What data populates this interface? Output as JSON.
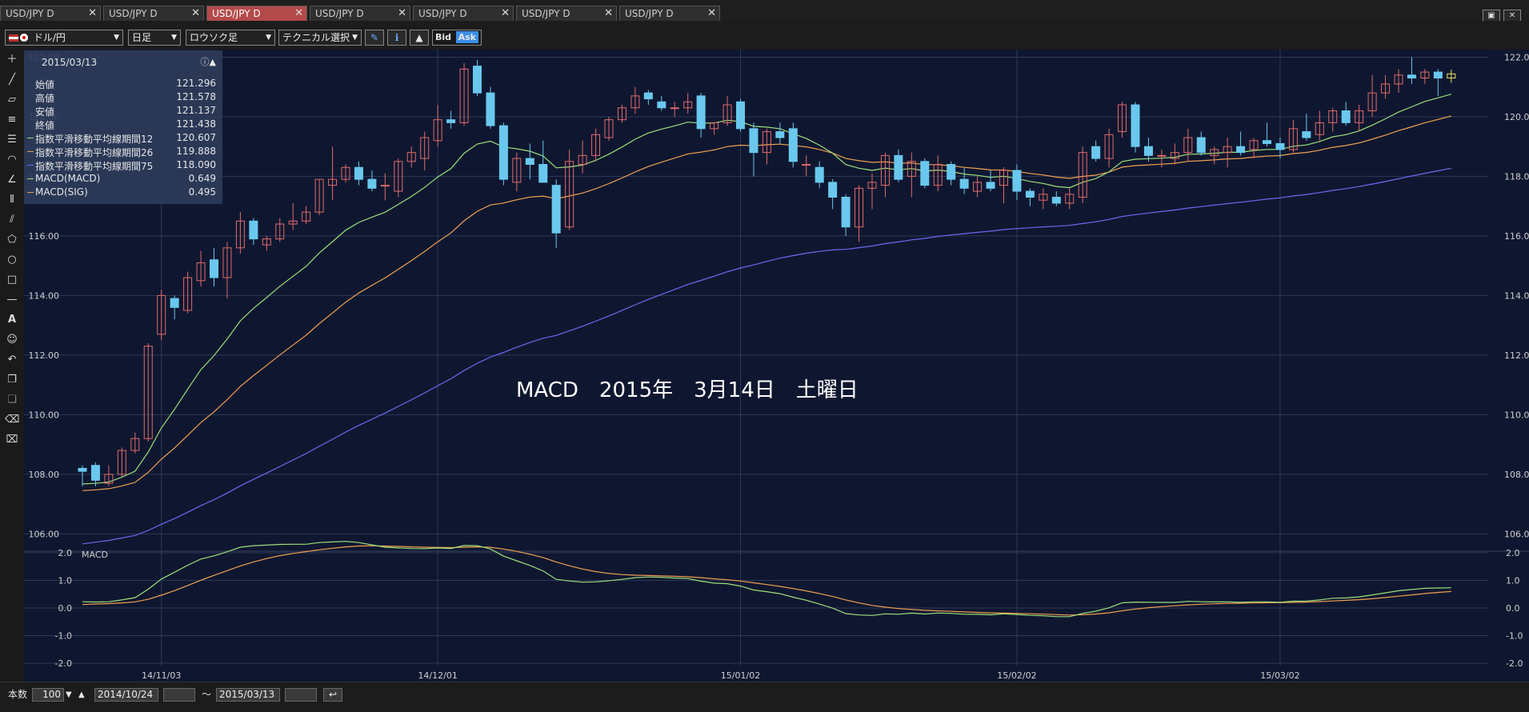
{
  "tabs": [
    {
      "label": "USD/JPY D",
      "active": false
    },
    {
      "label": "USD/JPY D",
      "active": false
    },
    {
      "label": "USD/JPY D",
      "active": true
    },
    {
      "label": "USD/JPY D",
      "active": false
    },
    {
      "label": "USD/JPY D",
      "active": false
    },
    {
      "label": "USD/JPY D",
      "active": false
    },
    {
      "label": "USD/JPY D",
      "active": false
    }
  ],
  "toolbar": {
    "currency_pair": "ドル/円",
    "timeframe": "日足",
    "chart_style": "ロウソク足",
    "technical": "テクニカル選択",
    "bid_label": "Bid",
    "ask_label": "Ask"
  },
  "info_panel": {
    "date": "2015/03/13",
    "rows": [
      {
        "label": "始値",
        "value": "121.296",
        "color": "#e6e6e6"
      },
      {
        "label": "高値",
        "value": "121.578",
        "color": "#e6e6e6"
      },
      {
        "label": "安値",
        "value": "121.137",
        "color": "#e6e6e6"
      },
      {
        "label": "終値",
        "value": "121.438",
        "color": "#e6e6e6"
      },
      {
        "label": "指数平滑移動平均線期間12",
        "value": "120.607",
        "color": "#9be07a"
      },
      {
        "label": "指数平滑移動平均線期間26",
        "value": "119.888",
        "color": "#f0a050"
      },
      {
        "label": "指数平滑移動平均線期間75",
        "value": "118.090",
        "color": "#6a6af0"
      },
      {
        "label": "MACD(MACD)",
        "value": "0.649",
        "color": "#9be07a"
      },
      {
        "label": "MACD(SIG)",
        "value": "0.495",
        "color": "#f0a050"
      }
    ]
  },
  "overlay_text": "MACD　2015年　3月14日　土曜日",
  "macd_label": "MACD",
  "bottom": {
    "count_label": "本数",
    "count_value": "100",
    "from_date": "2014/10/24",
    "tilde": "～",
    "to_date": "2015/03/13"
  },
  "chart_data": {
    "type": "candlestick",
    "symbol": "USD/JPY",
    "timeframe": "D",
    "price_ticks": [
      "122.00",
      "120.00",
      "118.00",
      "116.00",
      "114.00",
      "112.00",
      "110.00",
      "108.00",
      "106.00"
    ],
    "price_ylim": [
      105.5,
      122.2
    ],
    "macd_ticks": [
      "2.0",
      "1.0",
      "0.0",
      "-1.0",
      "-2.0"
    ],
    "macd_ylim": [
      -2.0,
      2.0
    ],
    "date_ticks": [
      "14/11/03",
      "14/12/01",
      "15/01/02",
      "15/02/02",
      "15/03/02"
    ],
    "date_tick_index": [
      6,
      27,
      50,
      71,
      91
    ],
    "colors": {
      "up": "#e06a6a",
      "down": "#6ac8ee",
      "ema12": "#9be07a",
      "ema26": "#f0a050",
      "ema75": "#6a6af0",
      "macd": "#9be07a",
      "signal": "#f0a050"
    },
    "candles": [
      {
        "o": 108.2,
        "h": 108.3,
        "l": 107.6,
        "c": 108.1
      },
      {
        "o": 108.3,
        "h": 108.4,
        "l": 107.6,
        "c": 107.8
      },
      {
        "o": 107.7,
        "h": 108.3,
        "l": 107.6,
        "c": 108.0
      },
      {
        "o": 108.0,
        "h": 108.9,
        "l": 107.9,
        "c": 108.8
      },
      {
        "o": 108.8,
        "h": 109.4,
        "l": 108.7,
        "c": 109.2
      },
      {
        "o": 109.2,
        "h": 112.4,
        "l": 109.1,
        "c": 112.3
      },
      {
        "o": 112.7,
        "h": 114.2,
        "l": 112.5,
        "c": 114.0
      },
      {
        "o": 113.9,
        "h": 114.0,
        "l": 113.2,
        "c": 113.6
      },
      {
        "o": 113.5,
        "h": 114.8,
        "l": 113.4,
        "c": 114.6
      },
      {
        "o": 114.5,
        "h": 115.5,
        "l": 114.3,
        "c": 115.1
      },
      {
        "o": 115.2,
        "h": 115.6,
        "l": 114.3,
        "c": 114.6
      },
      {
        "o": 114.6,
        "h": 115.8,
        "l": 113.9,
        "c": 115.6
      },
      {
        "o": 115.6,
        "h": 116.8,
        "l": 115.4,
        "c": 116.5
      },
      {
        "o": 116.5,
        "h": 116.6,
        "l": 115.7,
        "c": 115.9
      },
      {
        "o": 115.7,
        "h": 116.0,
        "l": 115.5,
        "c": 115.9
      },
      {
        "o": 115.9,
        "h": 116.6,
        "l": 115.8,
        "c": 116.4
      },
      {
        "o": 116.4,
        "h": 117.1,
        "l": 116.2,
        "c": 116.5
      },
      {
        "o": 116.5,
        "h": 117.0,
        "l": 116.4,
        "c": 116.8
      },
      {
        "o": 116.8,
        "h": 117.9,
        "l": 116.7,
        "c": 117.9
      },
      {
        "o": 117.7,
        "h": 119.0,
        "l": 117.2,
        "c": 117.9
      },
      {
        "o": 117.9,
        "h": 118.4,
        "l": 117.8,
        "c": 118.3
      },
      {
        "o": 118.3,
        "h": 118.5,
        "l": 117.7,
        "c": 117.9
      },
      {
        "o": 117.9,
        "h": 118.2,
        "l": 117.5,
        "c": 117.6
      },
      {
        "o": 117.7,
        "h": 118.1,
        "l": 117.2,
        "c": 117.7
      },
      {
        "o": 117.5,
        "h": 118.6,
        "l": 117.3,
        "c": 118.5
      },
      {
        "o": 118.5,
        "h": 119.0,
        "l": 118.3,
        "c": 118.8
      },
      {
        "o": 118.6,
        "h": 119.5,
        "l": 118.2,
        "c": 119.3
      },
      {
        "o": 119.2,
        "h": 120.4,
        "l": 119.0,
        "c": 119.9
      },
      {
        "o": 119.9,
        "h": 120.2,
        "l": 119.6,
        "c": 119.8
      },
      {
        "o": 119.8,
        "h": 121.8,
        "l": 119.7,
        "c": 121.6
      },
      {
        "o": 121.7,
        "h": 121.9,
        "l": 120.7,
        "c": 120.8
      },
      {
        "o": 120.8,
        "h": 121.0,
        "l": 119.6,
        "c": 119.7
      },
      {
        "o": 119.7,
        "h": 119.8,
        "l": 117.7,
        "c": 117.9
      },
      {
        "o": 117.8,
        "h": 118.8,
        "l": 117.5,
        "c": 118.6
      },
      {
        "o": 118.6,
        "h": 119.1,
        "l": 117.9,
        "c": 118.4
      },
      {
        "o": 118.4,
        "h": 119.2,
        "l": 117.8,
        "c": 117.8
      },
      {
        "o": 117.7,
        "h": 117.9,
        "l": 115.6,
        "c": 116.1
      },
      {
        "o": 116.3,
        "h": 118.9,
        "l": 116.2,
        "c": 118.5
      },
      {
        "o": 118.4,
        "h": 119.2,
        "l": 118.1,
        "c": 118.7
      },
      {
        "o": 118.7,
        "h": 119.6,
        "l": 118.5,
        "c": 119.4
      },
      {
        "o": 119.3,
        "h": 120.0,
        "l": 119.2,
        "c": 119.9
      },
      {
        "o": 119.9,
        "h": 120.4,
        "l": 119.8,
        "c": 120.3
      },
      {
        "o": 120.3,
        "h": 121.0,
        "l": 120.1,
        "c": 120.7
      },
      {
        "o": 120.8,
        "h": 120.9,
        "l": 120.4,
        "c": 120.6
      },
      {
        "o": 120.5,
        "h": 120.7,
        "l": 120.2,
        "c": 120.3
      },
      {
        "o": 120.3,
        "h": 120.5,
        "l": 120.0,
        "c": 120.3
      },
      {
        "o": 120.3,
        "h": 120.8,
        "l": 120.1,
        "c": 120.5
      },
      {
        "o": 120.7,
        "h": 120.8,
        "l": 119.3,
        "c": 119.6
      },
      {
        "o": 119.6,
        "h": 119.8,
        "l": 119.4,
        "c": 119.8
      },
      {
        "o": 119.8,
        "h": 120.7,
        "l": 119.7,
        "c": 120.4
      },
      {
        "o": 120.5,
        "h": 120.6,
        "l": 119.5,
        "c": 119.6
      },
      {
        "o": 119.6,
        "h": 119.8,
        "l": 118.0,
        "c": 118.8
      },
      {
        "o": 118.8,
        "h": 119.6,
        "l": 118.4,
        "c": 119.5
      },
      {
        "o": 119.5,
        "h": 119.8,
        "l": 119.1,
        "c": 119.3
      },
      {
        "o": 119.6,
        "h": 119.8,
        "l": 118.3,
        "c": 118.5
      },
      {
        "o": 118.4,
        "h": 118.7,
        "l": 118.0,
        "c": 118.4
      },
      {
        "o": 118.3,
        "h": 118.5,
        "l": 117.6,
        "c": 117.8
      },
      {
        "o": 117.8,
        "h": 117.9,
        "l": 116.9,
        "c": 117.3
      },
      {
        "o": 117.3,
        "h": 117.4,
        "l": 116.0,
        "c": 116.3
      },
      {
        "o": 116.3,
        "h": 117.7,
        "l": 115.8,
        "c": 117.6
      },
      {
        "o": 117.6,
        "h": 118.1,
        "l": 116.9,
        "c": 117.8
      },
      {
        "o": 117.7,
        "h": 118.8,
        "l": 117.3,
        "c": 118.7
      },
      {
        "o": 118.7,
        "h": 118.9,
        "l": 117.8,
        "c": 117.9
      },
      {
        "o": 118.0,
        "h": 118.8,
        "l": 117.3,
        "c": 118.5
      },
      {
        "o": 118.5,
        "h": 118.6,
        "l": 117.6,
        "c": 117.7
      },
      {
        "o": 117.7,
        "h": 118.7,
        "l": 117.5,
        "c": 118.4
      },
      {
        "o": 118.4,
        "h": 118.5,
        "l": 117.7,
        "c": 117.9
      },
      {
        "o": 117.9,
        "h": 118.3,
        "l": 117.4,
        "c": 117.6
      },
      {
        "o": 117.5,
        "h": 118.0,
        "l": 117.3,
        "c": 117.8
      },
      {
        "o": 117.8,
        "h": 118.2,
        "l": 117.5,
        "c": 117.6
      },
      {
        "o": 117.7,
        "h": 118.3,
        "l": 117.1,
        "c": 118.2
      },
      {
        "o": 118.2,
        "h": 118.4,
        "l": 117.2,
        "c": 117.5
      },
      {
        "o": 117.5,
        "h": 117.6,
        "l": 117.0,
        "c": 117.3
      },
      {
        "o": 117.2,
        "h": 117.6,
        "l": 116.9,
        "c": 117.4
      },
      {
        "o": 117.3,
        "h": 117.5,
        "l": 117.0,
        "c": 117.1
      },
      {
        "o": 117.1,
        "h": 117.6,
        "l": 116.9,
        "c": 117.4
      },
      {
        "o": 117.3,
        "h": 119.0,
        "l": 117.1,
        "c": 118.8
      },
      {
        "o": 119.0,
        "h": 119.2,
        "l": 118.5,
        "c": 118.6
      },
      {
        "o": 118.6,
        "h": 119.6,
        "l": 118.3,
        "c": 119.4
      },
      {
        "o": 119.5,
        "h": 120.5,
        "l": 119.3,
        "c": 120.4
      },
      {
        "o": 120.4,
        "h": 120.5,
        "l": 118.8,
        "c": 119.0
      },
      {
        "o": 119.0,
        "h": 119.3,
        "l": 118.5,
        "c": 118.7
      },
      {
        "o": 118.7,
        "h": 118.9,
        "l": 118.3,
        "c": 118.7
      },
      {
        "o": 118.6,
        "h": 119.1,
        "l": 118.4,
        "c": 118.8
      },
      {
        "o": 118.8,
        "h": 119.6,
        "l": 118.5,
        "c": 119.3
      },
      {
        "o": 119.3,
        "h": 119.5,
        "l": 118.7,
        "c": 118.8
      },
      {
        "o": 118.7,
        "h": 119.0,
        "l": 118.4,
        "c": 118.9
      },
      {
        "o": 118.8,
        "h": 119.3,
        "l": 118.3,
        "c": 119.0
      },
      {
        "o": 119.0,
        "h": 119.5,
        "l": 118.7,
        "c": 118.8
      },
      {
        "o": 118.9,
        "h": 119.3,
        "l": 118.6,
        "c": 119.2
      },
      {
        "o": 119.2,
        "h": 119.8,
        "l": 119.0,
        "c": 119.1
      },
      {
        "o": 119.1,
        "h": 119.3,
        "l": 118.6,
        "c": 118.9
      },
      {
        "o": 118.9,
        "h": 119.9,
        "l": 118.8,
        "c": 119.6
      },
      {
        "o": 119.5,
        "h": 120.1,
        "l": 119.2,
        "c": 119.3
      },
      {
        "o": 119.4,
        "h": 120.2,
        "l": 119.2,
        "c": 119.8
      },
      {
        "o": 119.8,
        "h": 120.3,
        "l": 119.5,
        "c": 120.2
      },
      {
        "o": 120.2,
        "h": 120.5,
        "l": 119.7,
        "c": 119.8
      },
      {
        "o": 119.8,
        "h": 120.4,
        "l": 119.5,
        "c": 120.2
      },
      {
        "o": 120.2,
        "h": 121.4,
        "l": 120.0,
        "c": 120.8
      },
      {
        "o": 120.8,
        "h": 121.4,
        "l": 120.6,
        "c": 121.1
      },
      {
        "o": 121.1,
        "h": 121.6,
        "l": 120.8,
        "c": 121.4
      },
      {
        "o": 121.4,
        "h": 122.0,
        "l": 121.1,
        "c": 121.3
      },
      {
        "o": 121.3,
        "h": 121.6,
        "l": 121.1,
        "c": 121.5
      },
      {
        "o": 121.5,
        "h": 121.6,
        "l": 120.7,
        "c": 121.3
      },
      {
        "o": 121.3,
        "h": 121.58,
        "l": 121.14,
        "c": 121.44
      }
    ]
  }
}
